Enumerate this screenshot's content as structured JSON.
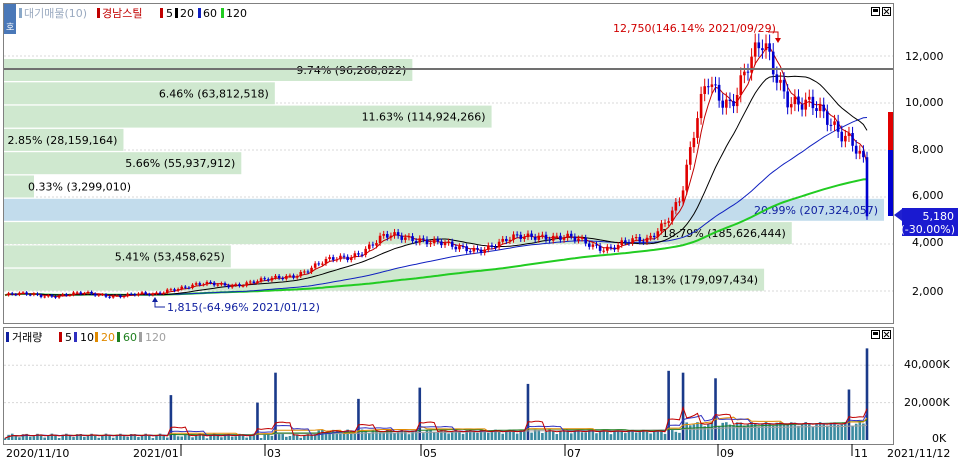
{
  "colors": {
    "up": "#e00000",
    "down": "#0000d0",
    "ma5": "#c00000",
    "ma20": "#000000",
    "ma60": "#1020c0",
    "ma120": "#22cc22",
    "ma10_vol": "#3030c0",
    "ma20_vol": "#e08a00",
    "ma60_vol": "#208020",
    "ma120_vol": "#a0a0a0",
    "vp_bar": "#cfe8cf",
    "vp_current": "#c2dcec",
    "grid": "#d8d8d8"
  },
  "price_panel": {
    "legend": {
      "prefix": "대기매물(10)",
      "name": "경남스틸",
      "ma_labels": [
        "5",
        "20",
        "60",
        "120"
      ]
    },
    "axis_ticks": [
      "12,000",
      "10,000",
      "8,000",
      "6,000",
      "4,000",
      "2,000"
    ],
    "current_price": "5,180",
    "current_change": "(-30.00%)",
    "high_annotation": "12,750(146.14% 2021/09/29)",
    "low_annotation": "1,815(-64.96% 2021/01/12)",
    "volume_profile": [
      {
        "label": "9.74% (96,268,822)"
      },
      {
        "label": "6.46% (63,812,518)"
      },
      {
        "label": "11.63% (114,924,266)"
      },
      {
        "label": "2.85% (28,159,164)"
      },
      {
        "label": "5.66% (55,937,912)"
      },
      {
        "label": "0.33% (3,299,010)"
      },
      {
        "label": "20.99% (207,324,057)"
      },
      {
        "label": "18.79% (185,626,444)"
      },
      {
        "label": "5.41% (53,458,625)"
      },
      {
        "label": "18.13% (179,097,434)"
      }
    ]
  },
  "volume_panel": {
    "legend": {
      "prefix": "거래량",
      "ma_labels": [
        "5",
        "10",
        "20",
        "60",
        "120"
      ]
    },
    "axis_ticks": [
      "40,000K",
      "20,000K",
      "0K"
    ]
  },
  "x_axis": {
    "labels": [
      "2020/11/10",
      "2021/01",
      "03",
      "05",
      "07",
      "09",
      "11",
      "2021/11/12"
    ]
  },
  "chart_data": {
    "type": "candlestick",
    "title": "경남스틸",
    "x_range": [
      "2020/11/10",
      "2021/11/12"
    ],
    "price_ylim": [
      500,
      13500
    ],
    "volume_ylim": [
      0,
      52000
    ],
    "volume_unit": "K",
    "moving_averages": [
      "5",
      "20",
      "60",
      "120"
    ],
    "high": {
      "value": 12750,
      "change_pct": 146.14,
      "date": "2021/09/29"
    },
    "low": {
      "value": 1815,
      "change_pct": -64.96,
      "date": "2021/01/12"
    },
    "last": {
      "value": 5180,
      "change_pct": -30.0,
      "date": "2021/11/12"
    },
    "price_path": [
      {
        "date": "2020/11/10",
        "close": 1820
      },
      {
        "date": "2020/12/15",
        "close": 1850
      },
      {
        "date": "2021/01/12",
        "close": 1815
      },
      {
        "date": "2021/01/20",
        "close": 2150
      },
      {
        "date": "2021/03/01",
        "close": 2400
      },
      {
        "date": "2021/03/15",
        "close": 2800
      },
      {
        "date": "2021/04/05",
        "close": 3500
      },
      {
        "date": "2021/04/20",
        "close": 4200
      },
      {
        "date": "2021/05/05",
        "close": 4350
      },
      {
        "date": "2021/05/20",
        "close": 3750
      },
      {
        "date": "2021/06/10",
        "close": 4000
      },
      {
        "date": "2021/06/25",
        "close": 4500
      },
      {
        "date": "2021/07/05",
        "close": 4200
      },
      {
        "date": "2021/07/25",
        "close": 3900
      },
      {
        "date": "2021/08/10",
        "close": 4100
      },
      {
        "date": "2021/08/25",
        "close": 6000
      },
      {
        "date": "2021/09/05",
        "close": 11000
      },
      {
        "date": "2021/09/15",
        "close": 10200
      },
      {
        "date": "2021/09/29",
        "close": 12300
      },
      {
        "date": "2021/10/10",
        "close": 10400
      },
      {
        "date": "2021/10/25",
        "close": 9200
      },
      {
        "date": "2021/11/05",
        "close": 8800
      },
      {
        "date": "2021/11/11",
        "close": 7400
      },
      {
        "date": "2021/11/12",
        "close": 5180
      }
    ],
    "volume_spikes_k": [
      {
        "date": "2021/01/20",
        "value": 24000
      },
      {
        "date": "2021/02/25",
        "value": 20000
      },
      {
        "date": "2021/03/05",
        "value": 36000
      },
      {
        "date": "2021/04/10",
        "value": 22000
      },
      {
        "date": "2021/05/05",
        "value": 28000
      },
      {
        "date": "2021/06/20",
        "value": 30000
      },
      {
        "date": "2021/08/20",
        "value": 37000
      },
      {
        "date": "2021/08/25",
        "value": 36000
      },
      {
        "date": "2021/09/08",
        "value": 33000
      },
      {
        "date": "2021/11/05",
        "value": 27000
      },
      {
        "date": "2021/11/12",
        "value": 49000
      }
    ],
    "volume_profile_pct": [
      9.74,
      6.46,
      11.63,
      2.85,
      5.66,
      0.33,
      20.99,
      18.79,
      5.41,
      18.13
    ],
    "volume_profile_qty": [
      96268822,
      63812518,
      114924266,
      28159164,
      55937912,
      3299010,
      207324057,
      185626444,
      53458625,
      179097434
    ]
  }
}
